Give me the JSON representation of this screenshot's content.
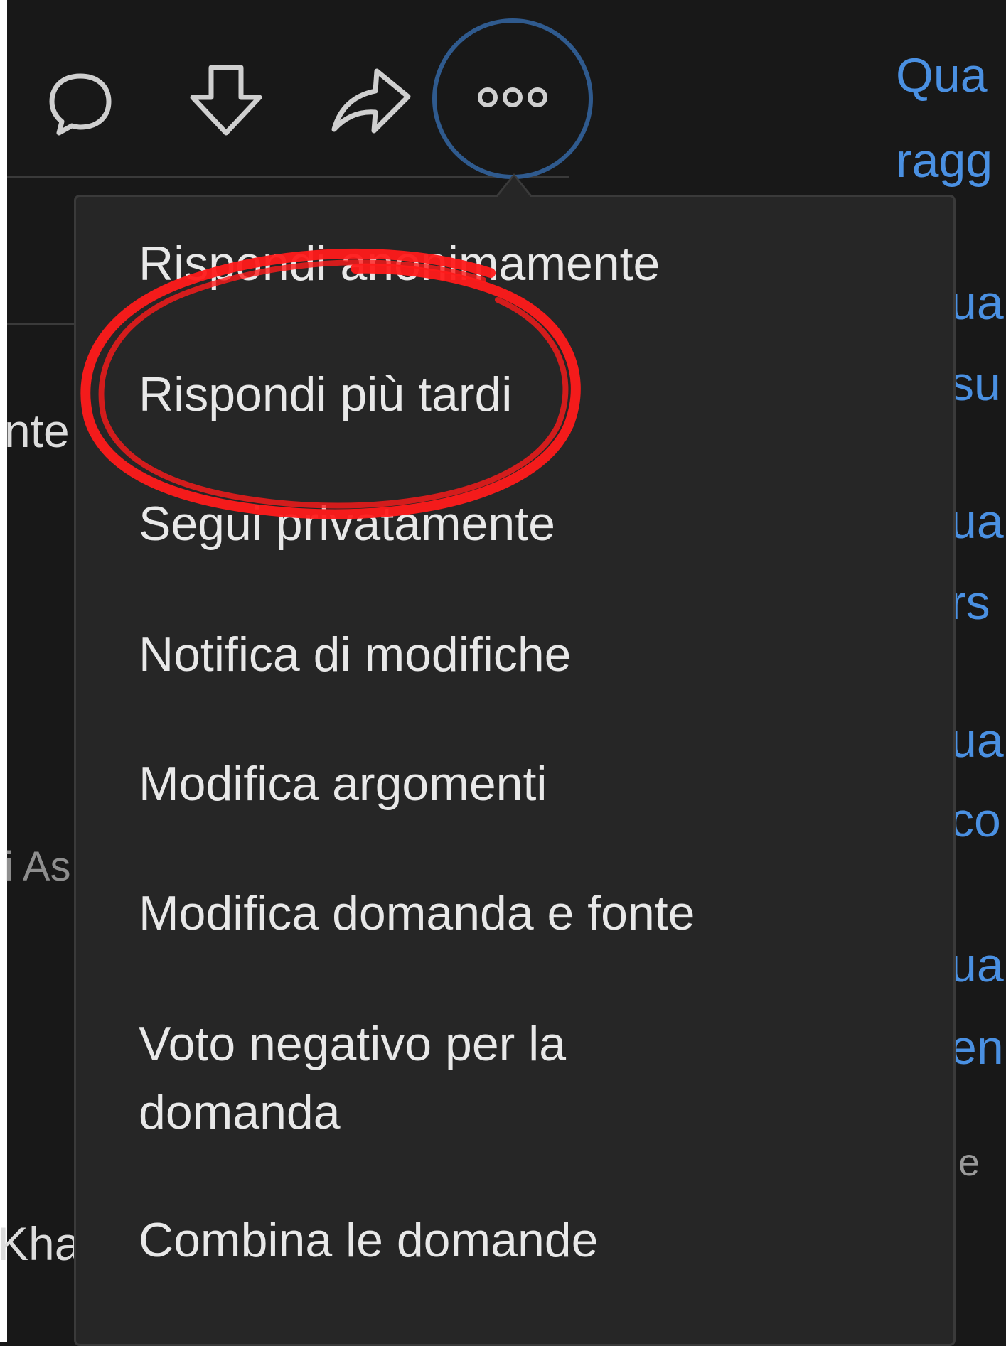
{
  "toolbar": {
    "icons": [
      "comment-icon",
      "downvote-icon",
      "share-icon",
      "more-options-icon"
    ]
  },
  "right_panel": {
    "lines": [
      "Qua",
      "ragg",
      "ua",
      "su",
      "ua",
      "rs",
      "ua",
      "co",
      "ua",
      "en",
      "ie"
    ]
  },
  "left_panel": {
    "lines": [
      "nte",
      "i As",
      "Kha"
    ]
  },
  "menu": {
    "items": [
      "Rispondi anonimamente",
      "Rispondi più tardi",
      "Segui privatamente",
      "Notifica di modifiche",
      "Modifica argomenti",
      "Modifica domanda e fonte",
      "Voto negativo per la domanda",
      "Combina le domande"
    ]
  },
  "colors": {
    "background": "#181818",
    "menu_background": "#262626",
    "link_blue": "#4a90e2",
    "focus_ring": "#2f5a8e",
    "annotation_red": "#ff1a1a"
  }
}
